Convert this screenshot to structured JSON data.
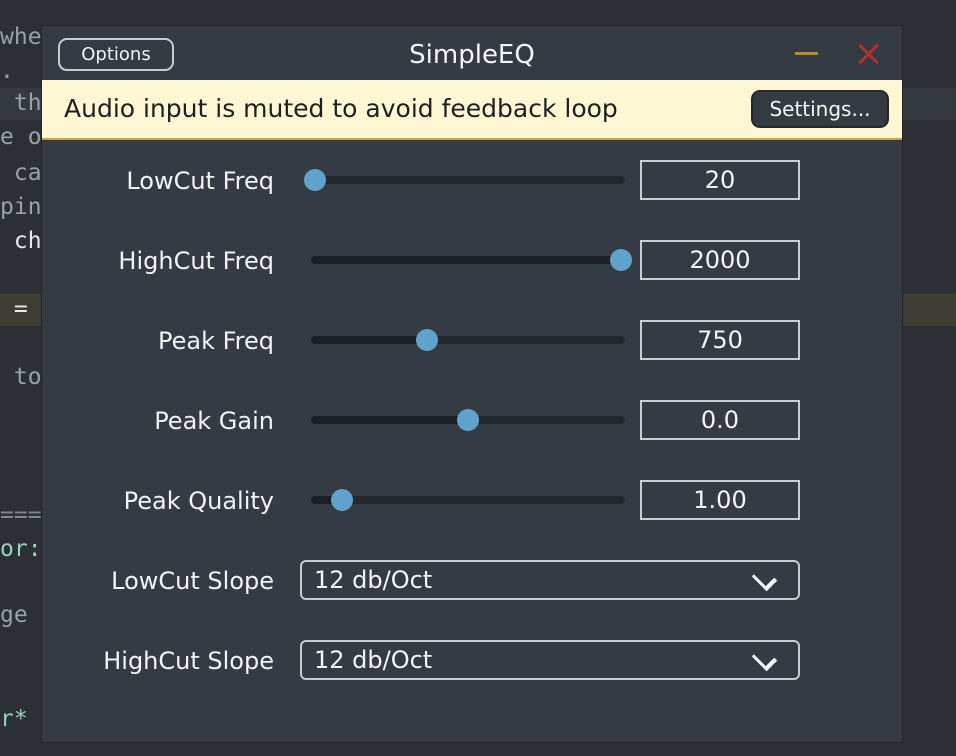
{
  "editor": {
    "lines": [
      {
        "text": "whe",
        "color": "#9aa1a8"
      },
      {
        "text": ".",
        "color": "#9aa1a8"
      },
      {
        "text": " th",
        "color": "#9aa1a8"
      },
      {
        "text": "e o",
        "color": "#9aa1a8"
      },
      {
        "text": " ca",
        "color": "#9aa1a8"
      },
      {
        "text": "pin",
        "color": "#9aa1a8"
      },
      {
        "text": " ch",
        "color": "#e6e8ea"
      },
      {
        "text": " =",
        "color": "#e6e8ea"
      },
      {
        "text": " to",
        "color": "#9aa1a8"
      },
      {
        "text": "===",
        "color": "#7f868d"
      },
      {
        "text": "or:",
        "color": "#8fd6b8"
      },
      {
        "text": "ge",
        "color": "#9aa1a8"
      },
      {
        "text": "r*",
        "color": "#8fd6b8"
      }
    ]
  },
  "window": {
    "title": "SimpleEQ",
    "options_label": "Options",
    "notice_text": "Audio input is muted to avoid feedback loop",
    "settings_label": "Settings..."
  },
  "sliders": [
    {
      "label": "LowCut Freq",
      "value": "20",
      "position": 0.0
    },
    {
      "label": "HighCut Freq",
      "value": "2000",
      "position": 1.0
    },
    {
      "label": "Peak Freq",
      "value": "750",
      "position": 0.37
    },
    {
      "label": "Peak Gain",
      "value": "0.0",
      "position": 0.5
    },
    {
      "label": "Peak Quality",
      "value": "1.00",
      "position": 0.1
    }
  ],
  "combos": [
    {
      "label": "LowCut Slope",
      "value": "12 db/Oct"
    },
    {
      "label": "HighCut Slope",
      "value": "12 db/Oct"
    }
  ]
}
